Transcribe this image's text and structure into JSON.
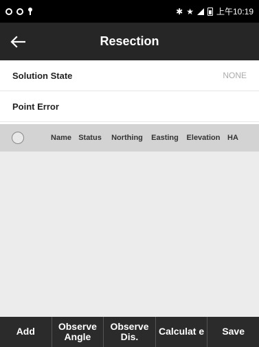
{
  "status_bar": {
    "icons": [
      "sync-icon",
      "sync-icon",
      "location-icon",
      "bluetooth-icon",
      "star-icon",
      "signal-icon",
      "battery-icon"
    ],
    "time": "上午10:19"
  },
  "app_bar": {
    "back_icon": "back-arrow-icon",
    "title": "Resection"
  },
  "solution_state": {
    "label": "Solution State",
    "value": "NONE"
  },
  "point_error": {
    "label": "Point Error"
  },
  "table": {
    "select_icon": "radio-circle-icon",
    "columns": [
      "Name",
      "Status",
      "Northing",
      "Easting",
      "Elevation",
      "HA"
    ],
    "rows": []
  },
  "toolbar": {
    "add": "Add",
    "observe_angle": "Observe Angle",
    "observe_dis": "Observe Dis.",
    "calculate": "Calculat e",
    "save": "Save"
  }
}
